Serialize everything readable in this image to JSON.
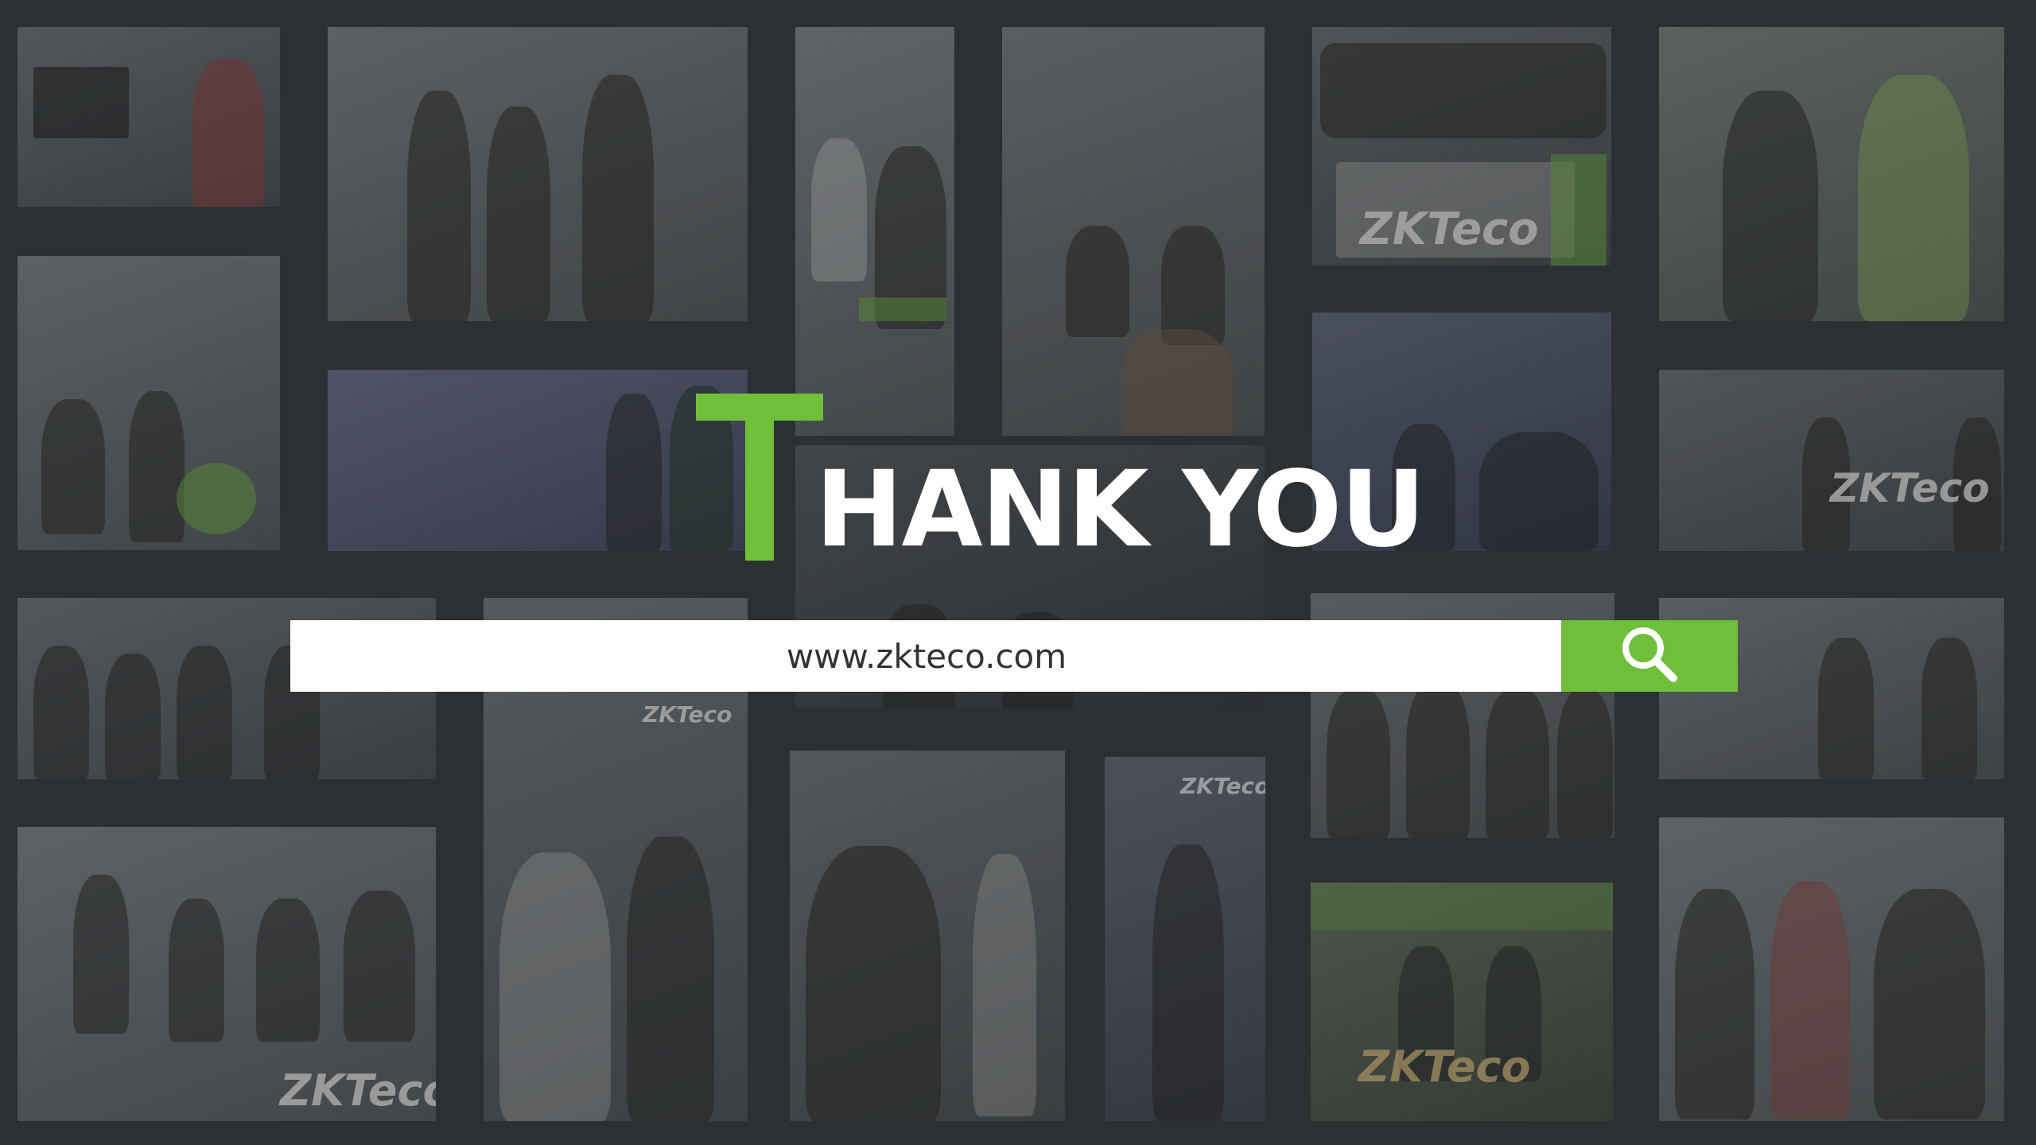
{
  "title": {
    "first_letter": "T",
    "rest": "HANK YOU"
  },
  "search": {
    "text": "www.zkteco.com",
    "button_icon": "search-icon"
  },
  "colors": {
    "background": "#2f3335",
    "accent": "#6fbf3a",
    "bar": "#ffffff"
  },
  "photos": {
    "logo_text": "ZKTeco"
  }
}
